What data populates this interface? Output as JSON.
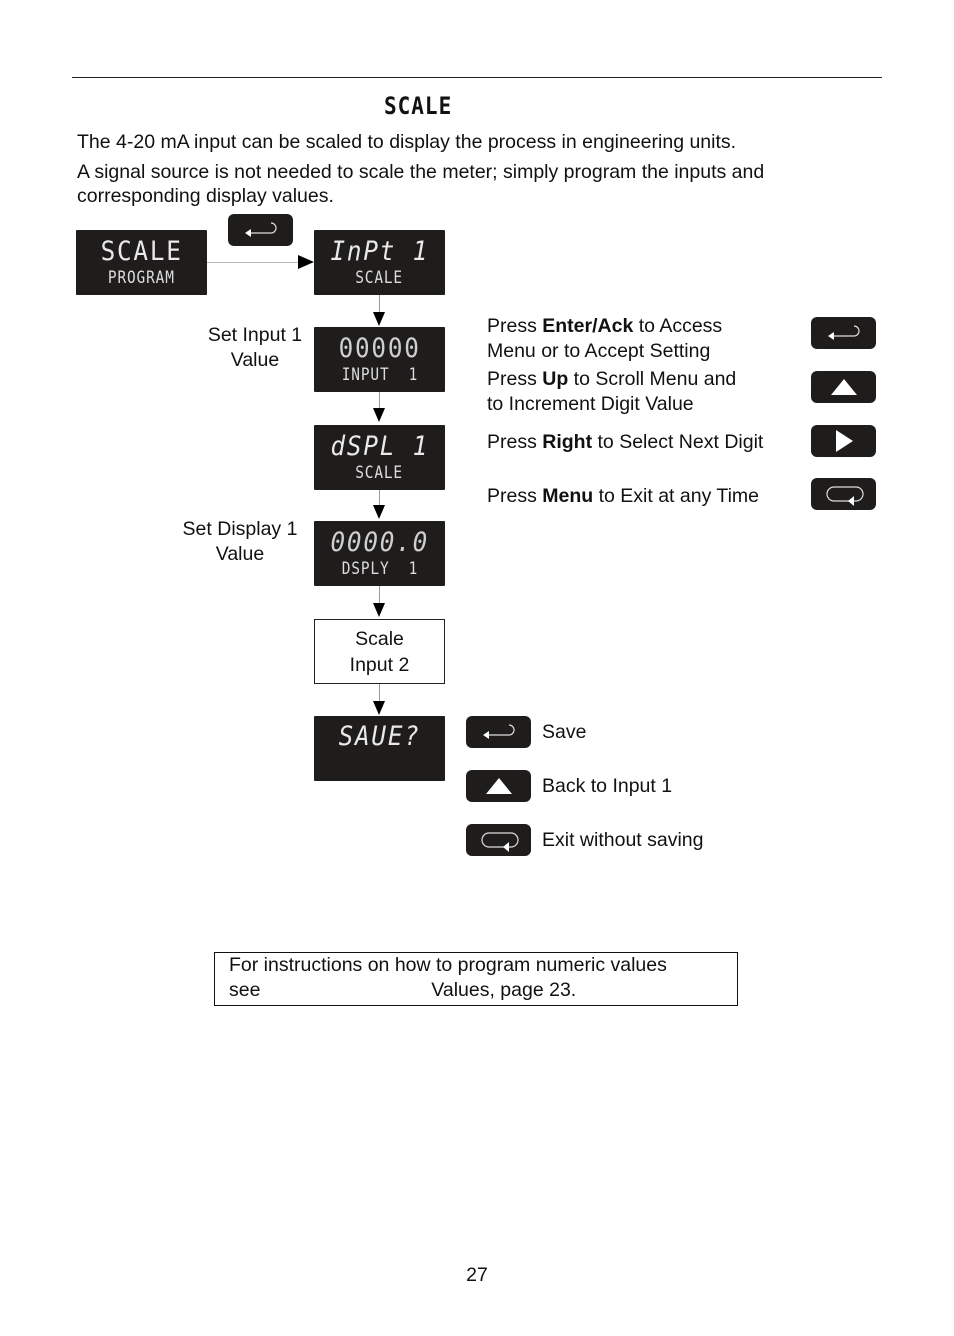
{
  "section": {
    "heading_lcd": "SCALE",
    "paragraphs": [
      "The 4-20 mA input can be scaled to display the process in engineering units.",
      "A signal source is not needed to scale the meter; simply program the inputs and corresponding display values."
    ]
  },
  "flow": {
    "start_display": {
      "top": "SCALE",
      "bottom": "PROGRAM"
    },
    "enter_key_icon": "enter-key-icon",
    "steps": [
      {
        "top": "InPt 1",
        "bottom": "SCALE",
        "side_label": ""
      },
      {
        "top": "00000",
        "bottom": "INPUT  1",
        "side_label_line1": "Set Input 1",
        "side_label_line2": "Value"
      },
      {
        "top": "dSPL 1",
        "bottom": "SCALE",
        "side_label": ""
      },
      {
        "top": "0000.0",
        "bottom": "DSPLY  1",
        "side_label_line1": "Set Display 1",
        "side_label_line2": "Value"
      }
    ],
    "scale_input2": {
      "line1": "Scale",
      "line2": "Input 2"
    },
    "save_display": {
      "top": "SAUE?"
    }
  },
  "key_help": [
    {
      "icon": "enter-key-icon",
      "prefix": "Press ",
      "bold": "Enter/Ack",
      "suffix": " to Access",
      "line2": "Menu or to Accept Setting"
    },
    {
      "icon": "up-key-icon",
      "prefix": "Press ",
      "bold": "Up",
      "suffix": " to Scroll Menu and",
      "line2": "to Increment Digit Value"
    },
    {
      "icon": "right-key-icon",
      "prefix": "Press ",
      "bold": "Right",
      "suffix": " to Select Next Digit",
      "line2": ""
    },
    {
      "icon": "menu-key-icon",
      "prefix": "Press ",
      "bold": "Menu",
      "suffix": " to Exit at any Time",
      "line2": ""
    }
  ],
  "save_options": [
    {
      "icon": "enter-key-icon",
      "label": "Save"
    },
    {
      "icon": "up-key-icon",
      "label": "Back to Input 1"
    },
    {
      "icon": "menu-key-icon",
      "label": "Exit without saving"
    }
  ],
  "note": {
    "line1": "For instructions on how to program numeric values",
    "line2_prefix": "see",
    "line2_suffix": "Values, page 23."
  },
  "page_number": "27"
}
